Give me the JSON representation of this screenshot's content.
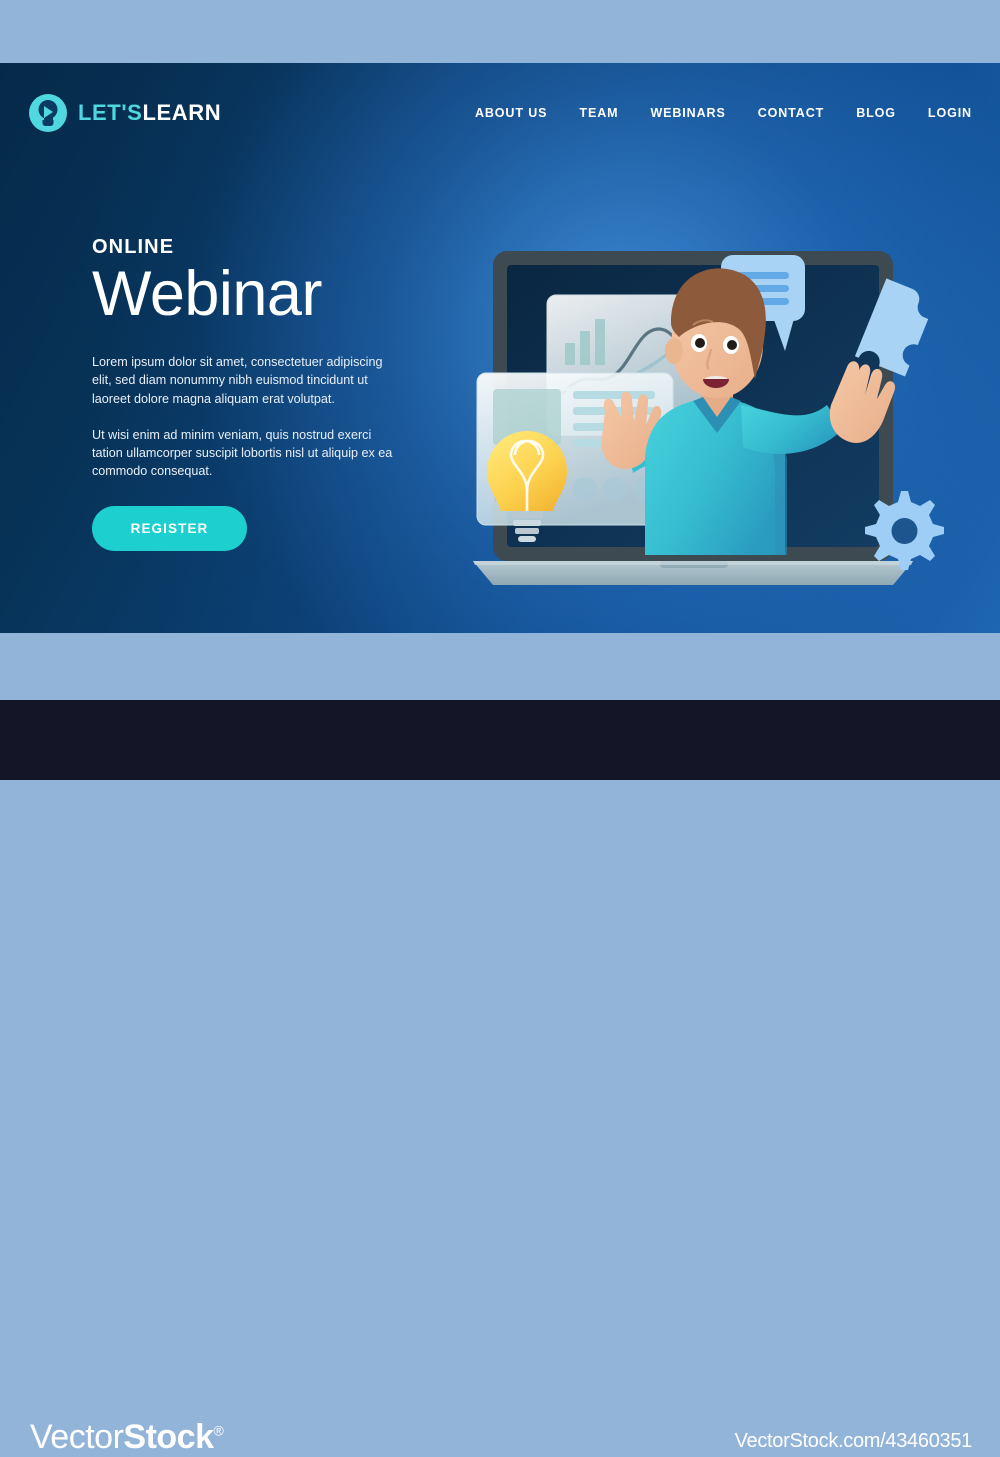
{
  "page": {
    "title": "Online Webinar Landing Page",
    "background_top_band": "#92b4d9",
    "design_gradient_dark": "#05294a",
    "design_gradient_light": "#1f68b4"
  },
  "header": {
    "logo": {
      "icon": "lightbulb-play-icon",
      "text_primary": "LET'S",
      "text_secondary": "LEARN",
      "color_primary": "#4fd8e0",
      "color_secondary": "#ffffff"
    },
    "nav": [
      {
        "label": "ABOUT US"
      },
      {
        "label": "TEAM"
      },
      {
        "label": "WEBINARS"
      },
      {
        "label": "CONTACT"
      },
      {
        "label": "BLOG"
      },
      {
        "label": "LOGIN"
      }
    ]
  },
  "hero": {
    "eyebrow": "ONLINE",
    "headline": "Webinar",
    "paragraph_1": "Lorem ipsum dolor sit amet, consectetuer adipiscing elit, sed diam nonummy nibh euismod tincidunt ut laoreet dolore magna aliquam erat volutpat.",
    "paragraph_2": "Ut wisi enim ad minim veniam, quis nostrud exerci tation ullamcorper suscipit lobortis nisl ut aliquip ex ea commodo consequat.",
    "cta_label": "REGISTER",
    "cta_color": "#1ecfd0"
  },
  "illustration": {
    "laptop": {
      "bezel_color": "#3d4a52",
      "screen_color": "#0d2d4e",
      "base_color": "#a5bcc4"
    },
    "person": {
      "skin_color": "#f0bc98",
      "hair_color": "#8d5a3b",
      "shirt_color": "#3fc9d6",
      "shirt_shadow_color": "#2f93b5",
      "pose": "arms-raised-waving"
    },
    "cards": [
      {
        "name": "chart-card",
        "elements": [
          "bar-chart",
          "line-chart"
        ],
        "bars": [
          22,
          34,
          46
        ],
        "fill": "rgba(255,255,255,0.82)"
      },
      {
        "name": "content-card",
        "elements": [
          "image-placeholder",
          "text-lines",
          "bar-chart",
          "dot-row"
        ],
        "bars": [
          16,
          30,
          22
        ],
        "text_lines": 4,
        "dots": 3,
        "fill": "rgba(255,255,255,0.86)"
      }
    ],
    "bulb": {
      "name": "lightbulb",
      "glass_color_light": "#ffe066",
      "glass_color_dark": "#f5b935",
      "base_color": "#b9c9d2"
    },
    "icons": [
      {
        "name": "speech-bubble-icon",
        "color": "#a8d3f5",
        "lines": 3
      },
      {
        "name": "puzzle-piece-icon",
        "color": "#a8d3f5"
      },
      {
        "name": "gear-icon",
        "color": "#9ecef5",
        "teeth": 8
      }
    ]
  },
  "watermark": {
    "brand_light": "Vector",
    "brand_bold": "Stock",
    "registered": "®",
    "url": "VectorStock.com/43460351",
    "bar_color": "#141527"
  }
}
